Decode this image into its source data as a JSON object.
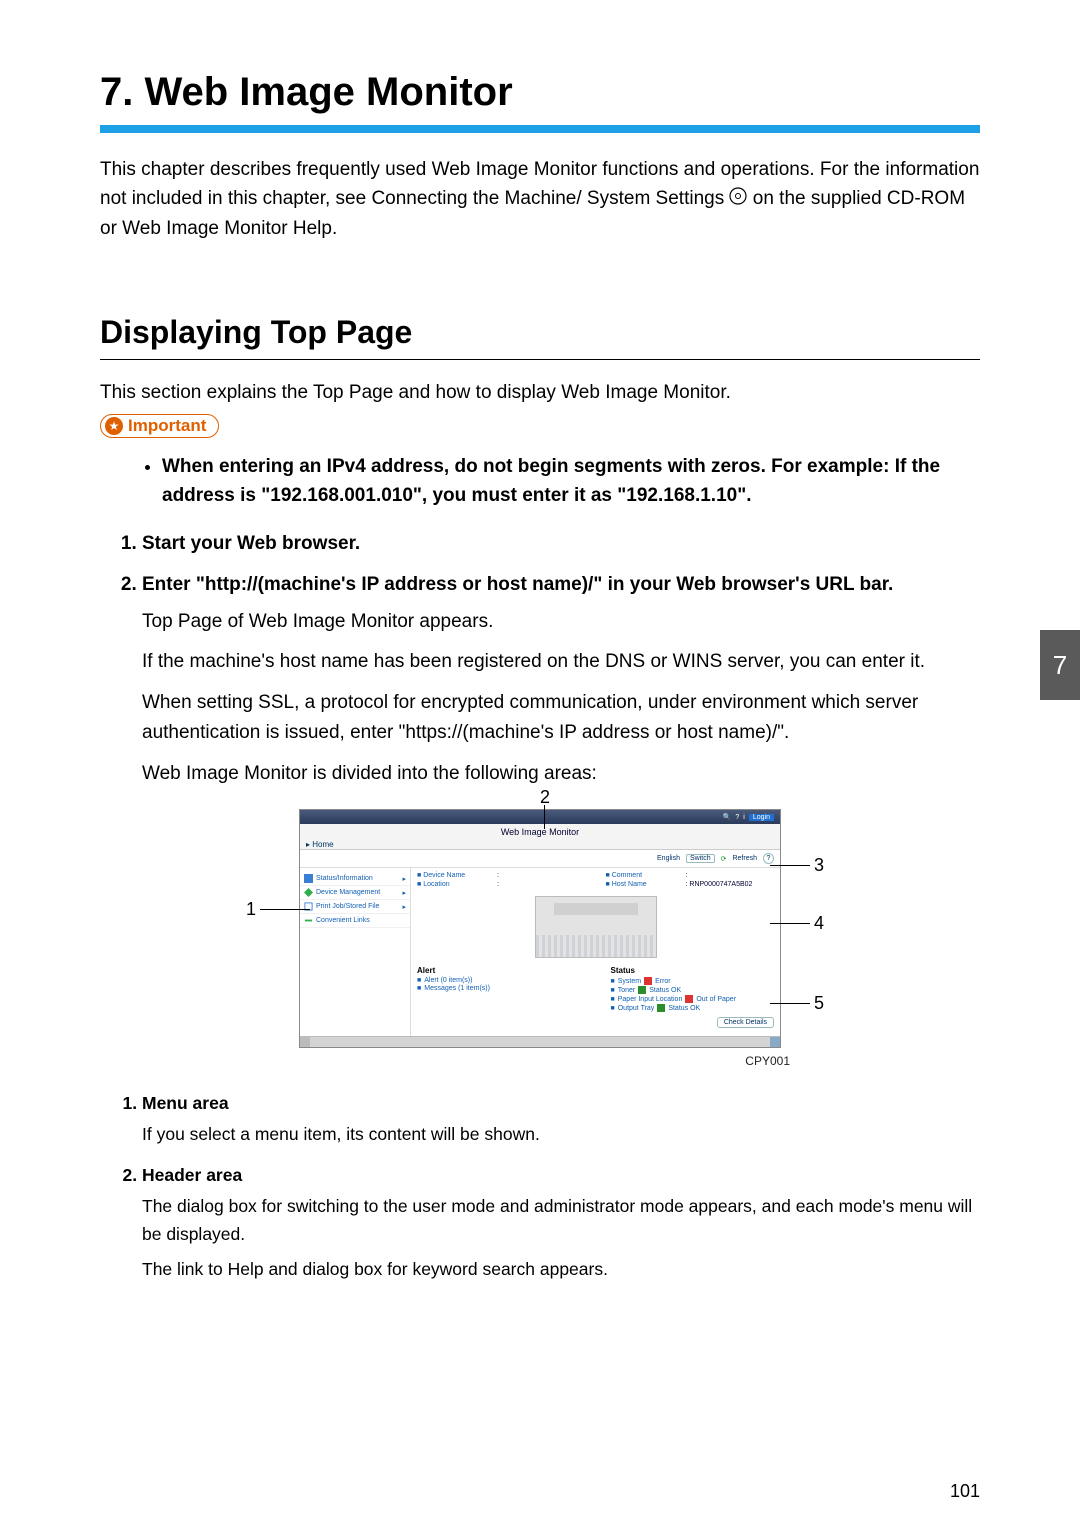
{
  "chapterTitle": "7. Web Image Monitor",
  "intro_a": "This chapter describes frequently used Web Image Monitor functions and operations. For the information not included in this chapter, see Connecting the Machine/ System Settings",
  "intro_b": " on the supplied CD-ROM or Web Image Monitor Help.",
  "sectionTitle": "Displaying Top Page",
  "sectionIntro": "This section explains the Top Page and how to display Web Image Monitor.",
  "importantLabel": "Important",
  "importantBullet": "When entering an IPv4 address, do not begin segments with zeros. For example: If the address is \"192.168.001.010\", you must enter it as \"192.168.1.10\".",
  "steps": {
    "s1": "Start your Web browser.",
    "s2": "Enter \"http://(machine's IP address or host name)/\" in your Web browser's URL bar.",
    "s2_body_a": "Top Page of Web Image Monitor appears.",
    "s2_body_b": "If the machine's host name has been registered on the DNS or WINS server, you can enter it.",
    "s2_body_c": "When setting SSL, a protocol for encrypted communication, under environment which server authentication is issued, enter \"https://(machine's IP address or host name)/\".",
    "s2_body_d": "Web Image Monitor is divided into the following areas:"
  },
  "callouts": {
    "c1": "1",
    "c2": "2",
    "c3": "3",
    "c4": "4",
    "c5": "5"
  },
  "wim": {
    "login": "Login",
    "title": "Web Image Monitor",
    "home": "Home",
    "english": "English",
    "switch": "Switch",
    "refresh": "Refresh",
    "help": "?",
    "menu": {
      "m1": "Status/Information",
      "m2": "Device Management",
      "m3": "Print Job/Stored File",
      "m4": "Convenient Links"
    },
    "infoLabels": {
      "devName": "Device Name",
      "location": "Location",
      "comment": "Comment",
      "hostName": "Host Name",
      "hostVal": "RNP0000747A5B02"
    },
    "alertHead": "Alert",
    "statusHead": "Status",
    "alerts": {
      "a1": "Alert (0 item(s))",
      "a2": "Messages (1 item(s))"
    },
    "status": {
      "s1": "System",
      "s1v": "Error",
      "s2": "Toner",
      "s2v": "Status OK",
      "s3": "Paper Input Location",
      "s3v": "Out of Paper",
      "s4": "Output Tray",
      "s4v": "Status OK"
    },
    "checkDetails": "Check Details"
  },
  "figureCode": "CPY001",
  "tabNumber": "7",
  "defs": {
    "d1_t": "Menu area",
    "d1_b": "If you select a menu item, its content will be shown.",
    "d2_t": "Header area",
    "d2_b1": "The dialog box for switching to the user mode and administrator mode appears, and each mode's menu will be displayed.",
    "d2_b2": "The link to Help and dialog box for keyword search appears."
  },
  "pageNumber": "101"
}
